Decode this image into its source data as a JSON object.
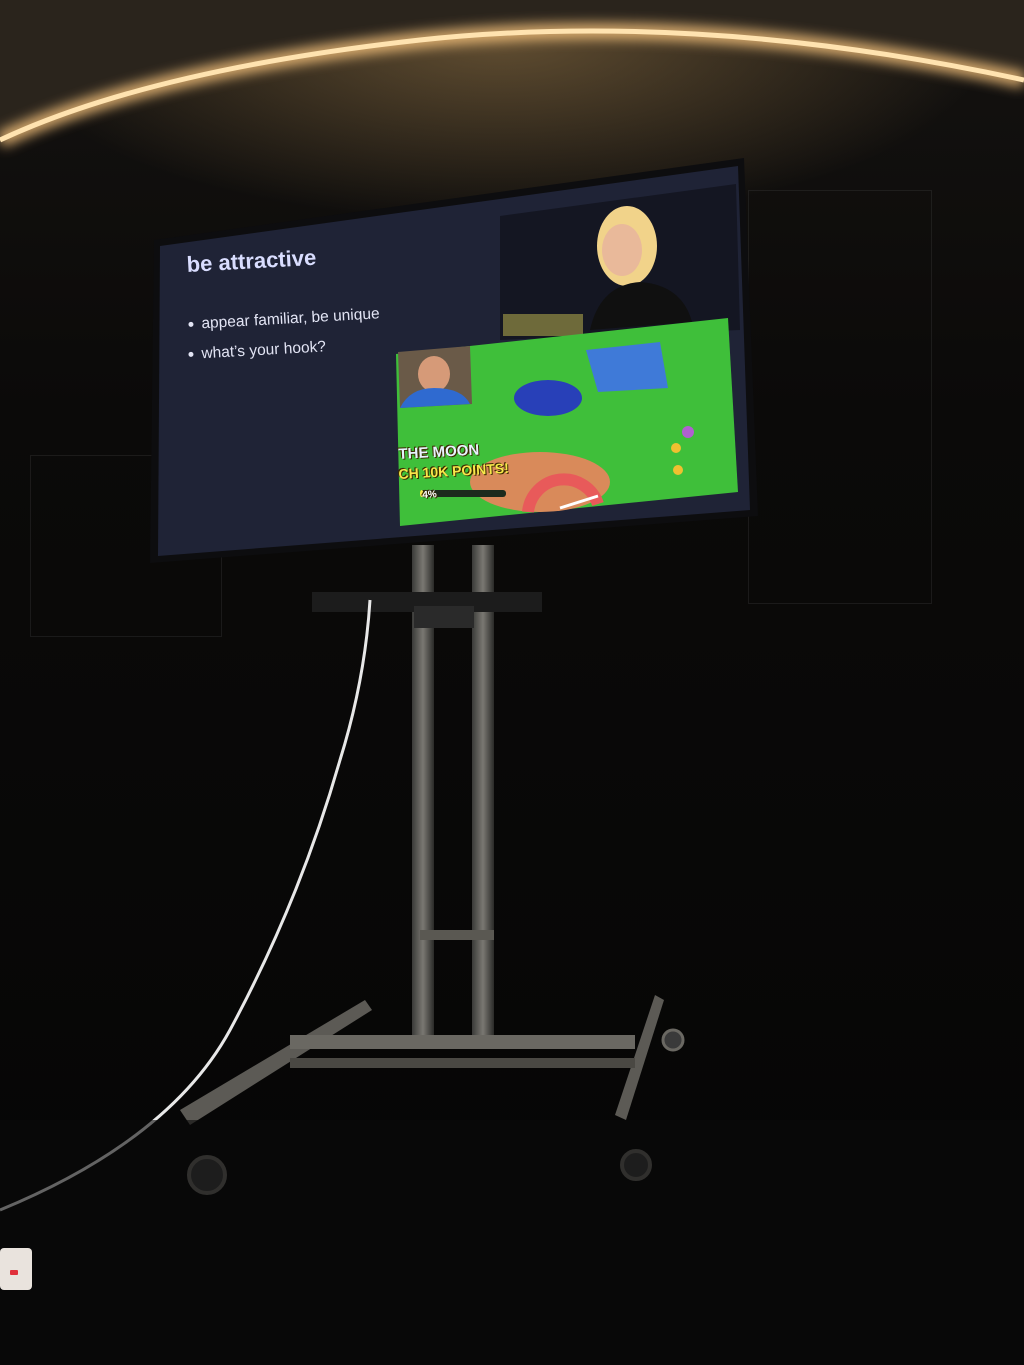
{
  "slide": {
    "title": "be attractive",
    "bullets": [
      "appear familiar, be unique",
      "what’s your hook?"
    ]
  },
  "game": {
    "banner_line1": "THE MOON",
    "banner_line2": "CH 10K POINTS!",
    "progress_label": "4%",
    "progress_value": 0.04
  },
  "colors": {
    "slide_bg": "#1f2336",
    "title_text": "#d9ddff",
    "game_grass": "#3fbf3a",
    "banner_yellow": "#f7e84a",
    "led_strip": "#f2c27a"
  }
}
